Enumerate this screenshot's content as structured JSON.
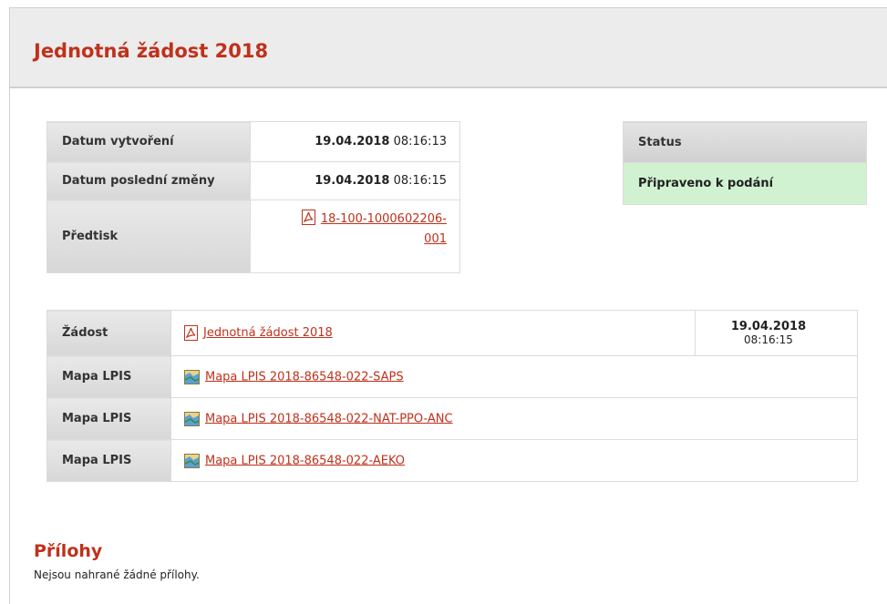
{
  "page": {
    "title": "Jednotná žádost 2018"
  },
  "info": {
    "rows": [
      {
        "label": "Datum vytvoření",
        "date": "19.04.2018",
        "time": "08:16:13"
      },
      {
        "label": "Datum poslední změny",
        "date": "19.04.2018",
        "time": "08:16:15"
      }
    ],
    "predtisk": {
      "label": "Předtisk",
      "link_line1": "18-100-1000602206-",
      "link_line2": "001",
      "icon": "pdf-icon"
    }
  },
  "status": {
    "header": "Status",
    "value": "Připraveno k podání",
    "color": "#d1f2d1"
  },
  "documents": [
    {
      "label": "Žádost",
      "link": "Jednotná žádost 2018",
      "icon": "pdf-icon",
      "date": "19.04.2018",
      "time": "08:16:15"
    },
    {
      "label": "Mapa LPIS",
      "link": "Mapa LPIS 2018-86548-022-SAPS",
      "icon": "map-icon"
    },
    {
      "label": "Mapa LPIS",
      "link": "Mapa LPIS 2018-86548-022-NAT-PPO-ANC",
      "icon": "map-icon"
    },
    {
      "label": "Mapa LPIS",
      "link": "Mapa LPIS 2018-86548-022-AEKO",
      "icon": "map-icon"
    }
  ],
  "attachments": {
    "title": "Přílohy",
    "note": "Nejsou nahrané žádné přílohy."
  },
  "colors": {
    "accent": "#c0311b",
    "header_bg": "#ececec"
  }
}
